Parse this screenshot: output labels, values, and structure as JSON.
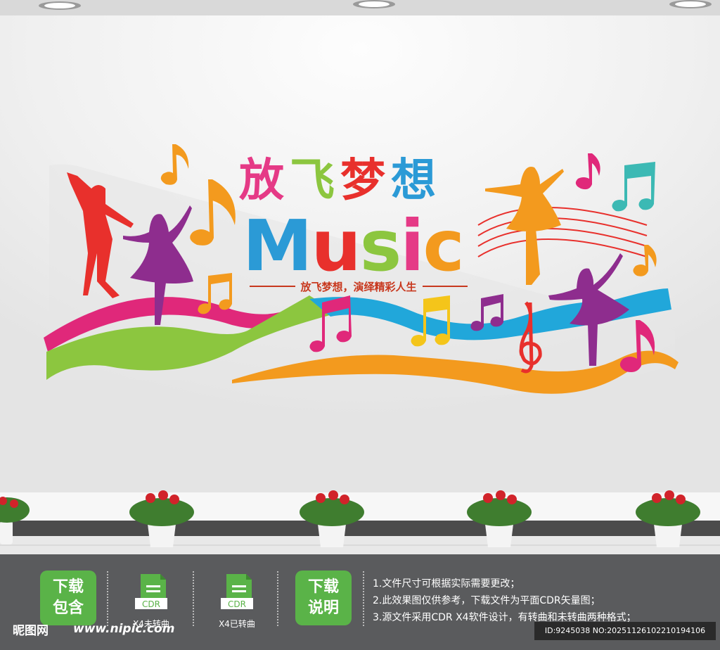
{
  "title_cn": [
    "放",
    "飞",
    "梦",
    "想"
  ],
  "title_cn_colors": [
    "#e53a86",
    "#8cc63f",
    "#e8302c",
    "#2b9ad6"
  ],
  "title_en": [
    "M",
    "u",
    "s",
    "i",
    "c"
  ],
  "title_en_colors": [
    "#2b9ad6",
    "#e8302c",
    "#8cc63f",
    "#e53a86",
    "#f39a1e"
  ],
  "slogan": "放飞梦想，演绎精彩人生",
  "colors": {
    "magenta": "#e0287a",
    "green": "#8cc63f",
    "blue": "#21a7da",
    "orange": "#f39a1e",
    "red": "#e8302c",
    "purple": "#8e2d8e",
    "teal": "#3cb9b4",
    "wall": "#f3f3f3"
  },
  "footer": {
    "download_includes": [
      "下载",
      "包含"
    ],
    "cdr_icon_text": "CDR",
    "cdr_x4_uncurved": "X4未转曲",
    "cdr_x4_curved": "X4已转曲",
    "download_notes": [
      "下载",
      "说明"
    ],
    "notes": [
      "1.文件尺寸可根据实际需要更改；",
      "2.此效果图仅供参考，下载文件为平面CDR矢量图；",
      "3.源文件采用CDR X4软件设计，有转曲和未转曲两种格式；"
    ],
    "watermark_logo": "昵图网",
    "watermark_url": "www.nipic.com",
    "id_text": "ID:9245038 NO:20251126102210194106"
  }
}
